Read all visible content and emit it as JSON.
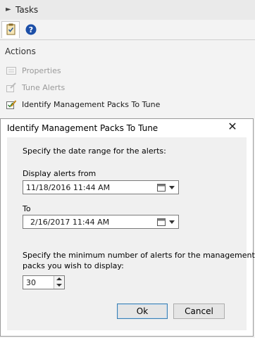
{
  "tasks": {
    "title": "Tasks"
  },
  "actions": {
    "heading": "Actions",
    "items": [
      {
        "label": "Properties",
        "icon": "properties-icon",
        "enabled": false
      },
      {
        "label": "Tune Alerts",
        "icon": "tune-alerts-icon",
        "enabled": false
      },
      {
        "label": "Identify Management Packs To Tune",
        "icon": "identify-packs-icon",
        "enabled": true
      }
    ]
  },
  "dialog": {
    "title": "Identify Management Packs To Tune",
    "date_range_prompt": "Specify the date range for the alerts:",
    "from_label": "Display alerts from",
    "from_value": "11/18/2016 11:44 AM",
    "to_label": "To",
    "to_value": "2/16/2017 11:44 AM",
    "min_prompt_line1": "Specify the minimum number of alerts for the management",
    "min_prompt_line2": "packs you wish to display:",
    "min_value": "30",
    "ok_label": "Ok",
    "cancel_label": "Cancel"
  },
  "colors": {
    "accent": "#1a5fb4",
    "dialog_body": "#f0f0f0",
    "pane": "#f3f3f3"
  }
}
